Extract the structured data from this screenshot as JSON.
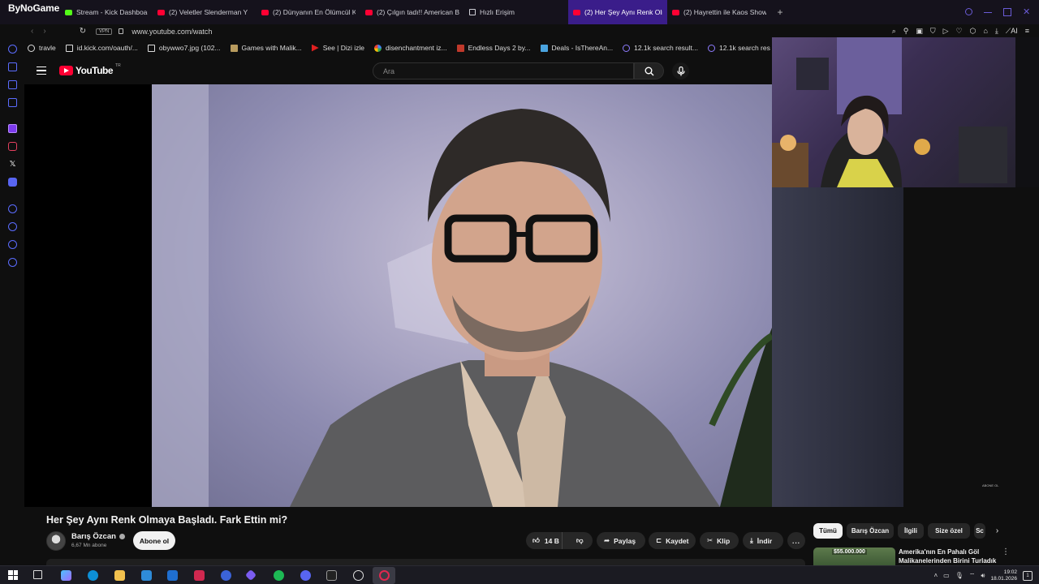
{
  "browser": {
    "brand": "ByNoGame",
    "tabs": [
      {
        "label": "Stream - Kick Dashboard",
        "favicon": "kick-icon",
        "active": false
      },
      {
        "label": "(2) Veletler Slenderman Y",
        "favicon": "youtube-icon",
        "active": false
      },
      {
        "label": "(2) Dünyanın En Ölümcül K",
        "favicon": "youtube-icon",
        "active": false
      },
      {
        "label": "(2) Çılgın tadı!! American B",
        "favicon": "youtube-icon",
        "active": false
      },
      {
        "label": "Hızlı Erişim",
        "favicon": "grid-icon",
        "active": false
      },
      {
        "label": "(2) Her Şey Aynı Renk Olm",
        "favicon": "youtube-icon",
        "active": true
      },
      {
        "label": "(2) Hayrettin ile Kaos Show",
        "favicon": "youtube-icon",
        "active": false
      }
    ],
    "new_tab": "+",
    "vpn_label": "VPN",
    "url": "www.youtube.com/watch",
    "ai_label": "AI",
    "bookmarks": [
      {
        "label": "travle",
        "icon": "compass-icon"
      },
      {
        "label": "id.kick.com/oauth/...",
        "icon": "page-icon"
      },
      {
        "label": "obywwo7.jpg (102...",
        "icon": "page-icon"
      },
      {
        "label": "Games with Malik...",
        "icon": "folder-icon"
      },
      {
        "label": "See | Dizi izle",
        "icon": "play-icon"
      },
      {
        "label": "disenchantment iz...",
        "icon": "google-icon"
      },
      {
        "label": "Endless Days 2 by...",
        "icon": "image-icon"
      },
      {
        "label": "Deals - IsThereAn...",
        "icon": "tag-icon"
      },
      {
        "label": "12.1k search result...",
        "icon": "search-icon"
      },
      {
        "label": "12.1k search res",
        "icon": "search-icon"
      }
    ],
    "sidebar_label": "GX",
    "sidebar_more": "..."
  },
  "youtube": {
    "logo_text": "YouTube",
    "logo_region": "TR",
    "search_placeholder": "Ara",
    "video": {
      "title": "Her Şey Aynı Renk Olmaya Başladı. Fark Ettin mi?",
      "watermark": "ABONE OL"
    },
    "channel": {
      "name": "Barış Özcan",
      "subscribers": "6,67 Mn abone",
      "subscribe_label": "Abone ol"
    },
    "actions": {
      "likes": "14 B",
      "share": "Paylaş",
      "save": "Kaydet",
      "clip": "Klip",
      "download": "İndir",
      "more": "..."
    },
    "chips": [
      "Tümü",
      "Barış Özcan",
      "İlgili",
      "Size özel",
      "Sc"
    ],
    "recommended": {
      "thumb_price": "$55.000.000",
      "title": "Amerika'nın En Pahalı Göl Malikanelerinden Birini Turladık"
    }
  },
  "taskbar": {
    "time": "19:02",
    "date": "18.01.2026",
    "notification_count": "1"
  },
  "colors": {
    "browser_accent": "#3a1d8a",
    "youtube_red": "#ff0033",
    "background": "#0f0f0f"
  }
}
